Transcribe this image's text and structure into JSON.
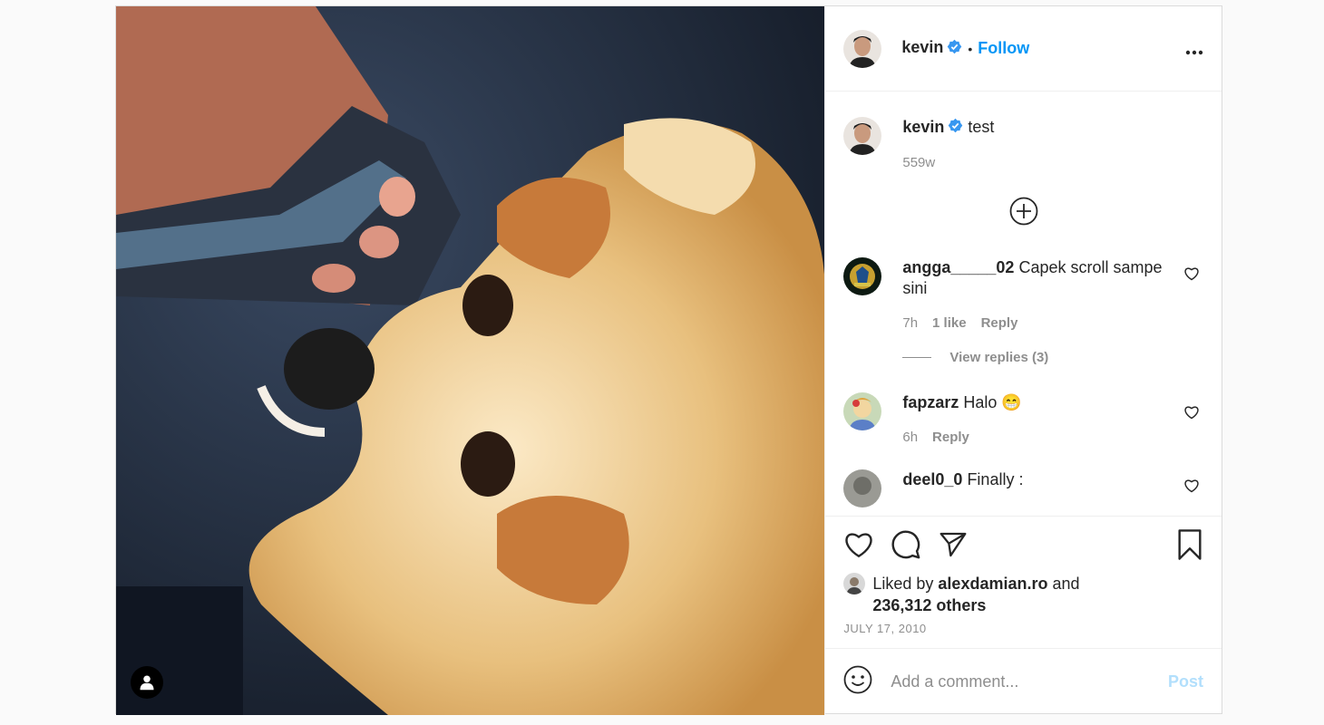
{
  "header": {
    "username": "kevin",
    "separator": "•",
    "follow_label": "Follow",
    "more_label": "···"
  },
  "caption": {
    "username": "kevin",
    "text": "test",
    "time": "559w"
  },
  "comments": [
    {
      "username": "angga_____02",
      "text": "Capek scroll sampe sini",
      "time": "7h",
      "likes": "1 like",
      "reply_label": "Reply",
      "view_replies": "View replies (3)"
    },
    {
      "username": "fapzarz",
      "text": "Halo 😁",
      "time": "6h",
      "reply_label": "Reply"
    },
    {
      "username": "deel0_0",
      "text": "Finally :"
    }
  ],
  "likes": {
    "prefix": "Liked by",
    "liker": "alexdamian.ro",
    "connector": "and",
    "others": "236,312 others"
  },
  "date": "JULY 17, 2010",
  "comment_box": {
    "placeholder": "Add a comment...",
    "post_label": "Post"
  },
  "colors": {
    "accent": "#0095f6",
    "post_disabled": "#b2dffc",
    "verified": "#3897f0"
  },
  "icons": {
    "verified": "verified-badge-icon",
    "more": "more-options-icon",
    "add": "plus-circle-icon",
    "like": "heart-icon",
    "comment": "comment-icon",
    "share": "paper-plane-icon",
    "save": "bookmark-icon",
    "emoji": "emoji-icon",
    "user_tag": "user-tag-icon"
  }
}
